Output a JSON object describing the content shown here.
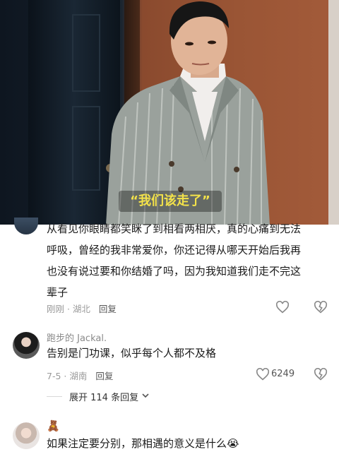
{
  "video": {
    "caption": "“我们该走了”"
  },
  "comments": [
    {
      "text": "从看见你眼睛都笑眯了到相看两相厌，真的心痛到无法呼吸，曾经的我非常爱你，你还记得从哪天开始后我再也没有说过要和你结婚了吗，因为我知道我们走不完这辈子",
      "lines": [
        "从看见你眼睛都笑眯了到相看两相厌，真的心痛到无法",
        "呼吸，曾经的我非常爱你，你还记得从哪天开始后我再",
        "也没有说过要和你结婚了吗，因为我知道我们走不完这",
        "辈子"
      ],
      "time_location": "刚刚 · 湖北",
      "reply_label": "回复"
    },
    {
      "username": "跑步的 Jackal.",
      "text": "告别是门功课，似乎每个人都不及格",
      "time_location": "7-5 · 湖南",
      "reply_label": "回复",
      "like_count": "6249",
      "expand_label": "展开 114 条回复"
    },
    {
      "username_emoji": "🧸",
      "text": "如果注定要分别，那相遇的意义是什么😭"
    }
  ],
  "icons": {
    "like": "heart-outline-icon",
    "dislike": "broken-heart-icon",
    "expand": "chevron-down-icon"
  },
  "colors": {
    "caption": "#f3e24a",
    "meta_text": "#9a9a9a",
    "body_text": "#1a1a1a"
  }
}
